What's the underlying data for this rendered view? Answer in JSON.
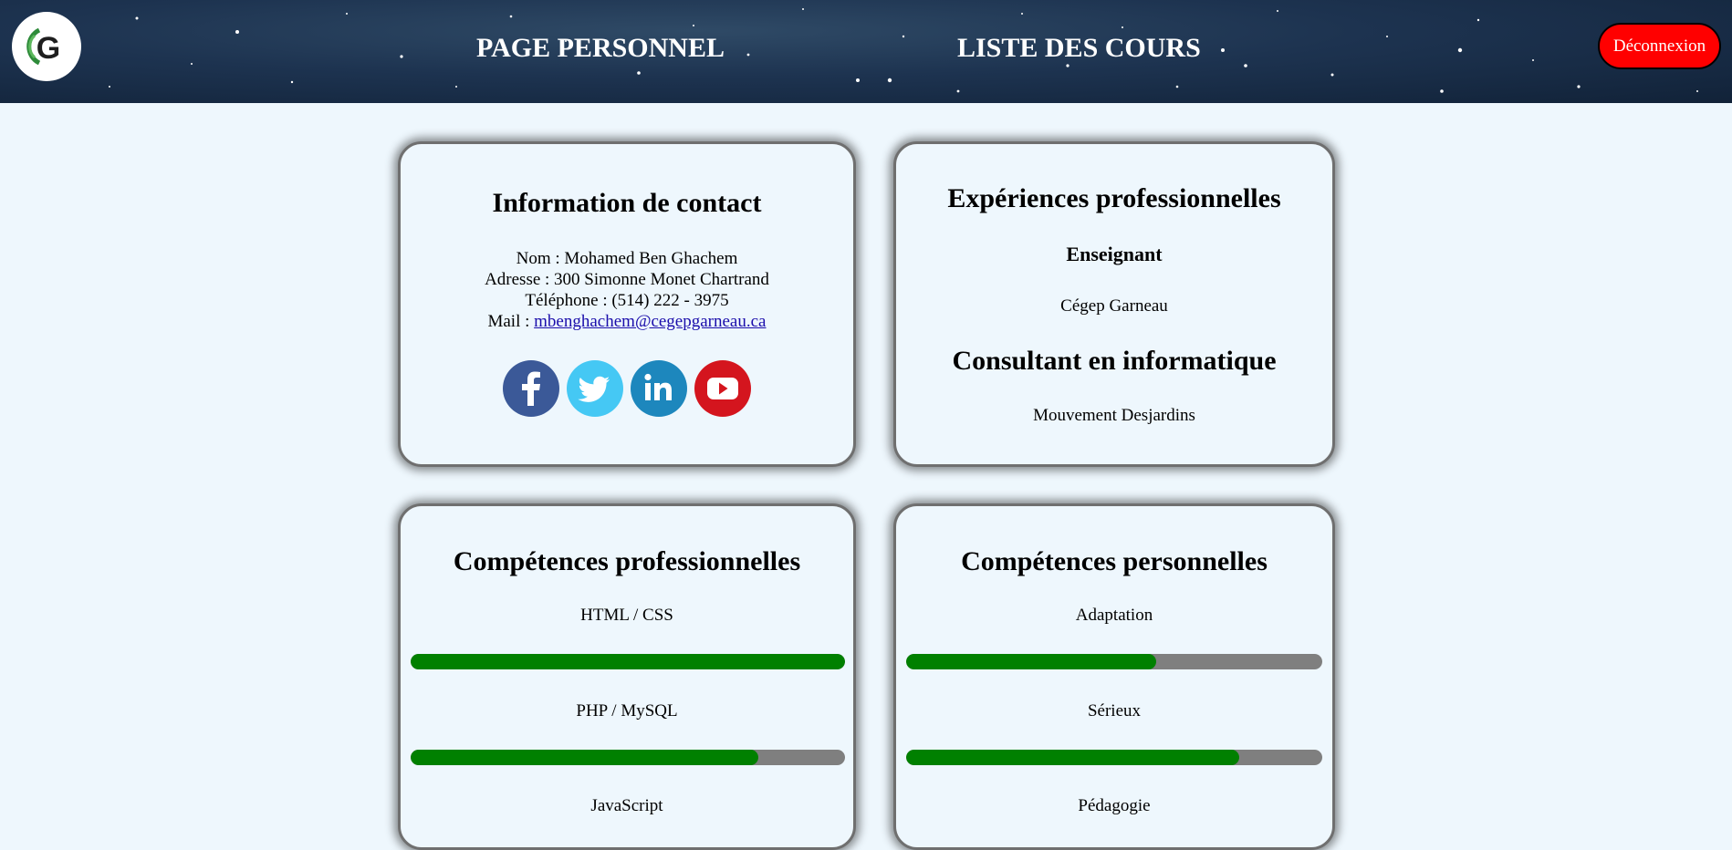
{
  "header": {
    "logo_letter": "G",
    "nav": [
      {
        "label": "PAGE PERSONNEL"
      },
      {
        "label": "LISTE DES COURS"
      }
    ],
    "logout_label": "Déconnexion",
    "logout_color": "#ff0000"
  },
  "contact": {
    "title": "Information de contact",
    "name_line": "Nom : Mohamed Ben Ghachem",
    "address_line": "Adresse : 300 Simonne Monet Chartrand",
    "phone_line": "Téléphone : (514) 222 - 3975",
    "mail_prefix": "Mail : ",
    "mail": "mbenghachem@cegepgarneau.ca",
    "socials": [
      {
        "icon": "facebook-icon",
        "color": "#3b5998"
      },
      {
        "icon": "twitter-icon",
        "color": "#45c8f4"
      },
      {
        "icon": "linkedin-icon",
        "color": "#1d87bd"
      },
      {
        "icon": "youtube-icon",
        "color": "#d4151e"
      }
    ]
  },
  "experiences": {
    "title": "Expériences professionnelles",
    "items": [
      {
        "role": "Enseignant",
        "place": "Cégep Garneau"
      },
      {
        "role": "Consultant en informatique",
        "place": "Mouvement Desjardins"
      }
    ]
  },
  "pro_skills": {
    "title": "Compétences professionnelles",
    "skills": [
      {
        "label": "HTML / CSS",
        "level": 1.0
      },
      {
        "label": "PHP / MySQL",
        "level": 0.8
      },
      {
        "label": "JavaScript",
        "level": null
      }
    ]
  },
  "perso_skills": {
    "title": "Compétences personnelles",
    "skills": [
      {
        "label": "Adaptation",
        "level": 0.6
      },
      {
        "label": "Sérieux",
        "level": 0.8
      },
      {
        "label": "Pédagogie",
        "level": null
      }
    ]
  },
  "colors": {
    "page_bg": "#eef7fd",
    "bar_fill": "#008000",
    "bar_track": "#7f7f7f"
  }
}
